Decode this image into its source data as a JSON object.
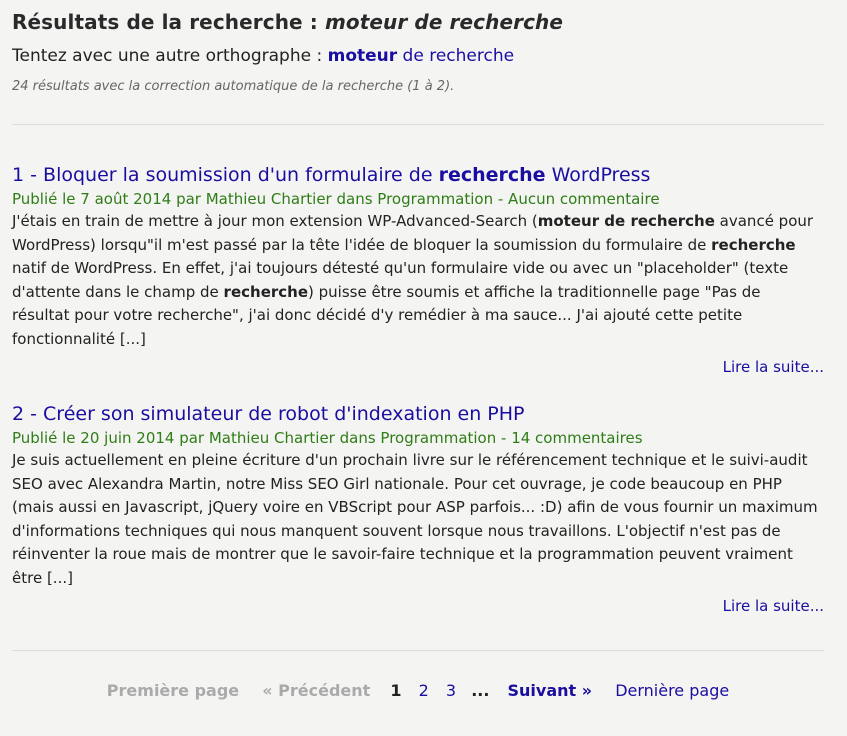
{
  "header": {
    "title_prefix": "Résultats de la recherche : ",
    "title_query": "moteur de recherche",
    "spell_prefix": "Tentez avec une autre orthographe : ",
    "spell_word1": "moteur",
    "spell_rest": " de recherche",
    "summary": "24 résultats avec la correction automatique de la recherche (1 à 2)."
  },
  "results": [
    {
      "num": "1 - ",
      "title_a": "Bloquer la soumission d'un formulaire de ",
      "title_b": "recherche",
      "title_c": " WordPress",
      "meta": "Publié le 7 août 2014 par Mathieu Chartier dans Programmation - Aucun commentaire",
      "ex1": "J'étais en train de mettre à jour mon extension WP-Advanced-Search (",
      "ex2": "moteur de recherche",
      "ex3": " avancé pour WordPress) lorsqu\"il m'est passé par la tête l'idée de bloquer la soumission du formulaire de ",
      "ex4": "recherche",
      "ex5": " natif de WordPress. En effet, j'ai toujours détesté qu'un formulaire vide ou avec un \"placeholder\" (texte d'attente dans le champ de ",
      "ex6": "recherche",
      "ex7": ") puisse être soumis et affiche la traditionnelle page \"Pas de résultat pour votre recherche\", j'ai donc décidé d'y remédier à ma sauce... J'ai ajouté cette petite fonctionnalité [...]",
      "more": "Lire la suite..."
    },
    {
      "num": "2 - ",
      "title": "Créer son simulateur de robot d'indexation en PHP",
      "meta": "Publié le 20 juin 2014 par Mathieu Chartier dans Programmation - 14 commentaires",
      "excerpt": "Je suis actuellement en pleine écriture d'un prochain livre sur le référencement technique et le suivi-audit SEO avec Alexandra Martin, notre Miss SEO Girl nationale. Pour cet ouvrage, je code beaucoup en PHP (mais aussi en Javascript, jQuery voire en VBScript pour ASP parfois... :D) afin de vous fournir un maximum d'informations techniques qui nous manquent souvent lorsque nous travaillons. L'objectif n'est pas de réinventer la roue mais de montrer que le savoir-faire technique et la programmation peuvent vraiment être [...]",
      "more": "Lire la suite..."
    }
  ],
  "pager": {
    "first": "Première page",
    "prev": "« Précédent",
    "current": "1",
    "p2": "2",
    "p3": "3",
    "dots": "...",
    "next": "Suivant »",
    "last": "Dernière page"
  }
}
